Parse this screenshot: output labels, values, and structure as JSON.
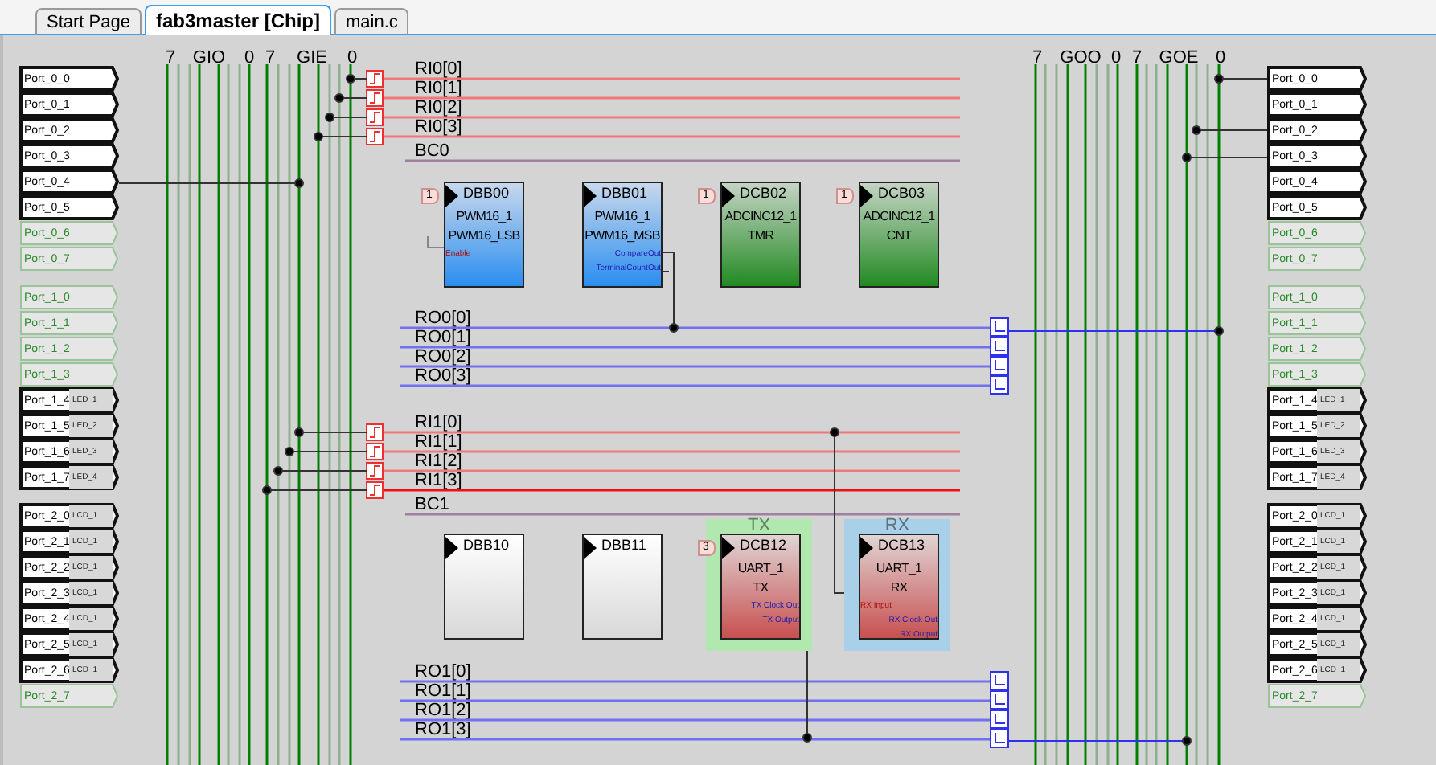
{
  "tabs": [
    {
      "label": "Start Page",
      "selected": false
    },
    {
      "label": "fab3master [Chip]",
      "selected": true
    },
    {
      "label": "main.c",
      "selected": false
    }
  ],
  "left_bus_header": [
    "7",
    "GIO",
    "0",
    "7",
    "GIE",
    "0"
  ],
  "right_bus_header": [
    "7",
    "GOO",
    "0",
    "7",
    "GOE",
    "0"
  ],
  "left_ports": [
    [
      {
        "label": "Port_0_0",
        "enabled": true
      },
      {
        "label": "Port_0_1",
        "enabled": true
      },
      {
        "label": "Port_0_2",
        "enabled": true
      },
      {
        "label": "Port_0_3",
        "enabled": true
      },
      {
        "label": "Port_0_4",
        "enabled": true
      },
      {
        "label": "Port_0_5",
        "enabled": true
      },
      {
        "label": "Port_0_6",
        "enabled": false
      },
      {
        "label": "Port_0_7",
        "enabled": false
      }
    ],
    [
      {
        "label": "Port_1_0",
        "enabled": false
      },
      {
        "label": "Port_1_1",
        "enabled": false
      },
      {
        "label": "Port_1_2",
        "enabled": false
      },
      {
        "label": "Port_1_3",
        "enabled": false
      },
      {
        "label": "Port_1_4",
        "enabled": true,
        "alias": "LED_1"
      },
      {
        "label": "Port_1_5",
        "enabled": true,
        "alias": "LED_2"
      },
      {
        "label": "Port_1_6",
        "enabled": true,
        "alias": "LED_3"
      },
      {
        "label": "Port_1_7",
        "enabled": true,
        "alias": "LED_4"
      }
    ],
    [
      {
        "label": "Port_2_0",
        "enabled": true,
        "alias": "LCD_1"
      },
      {
        "label": "Port_2_1",
        "enabled": true,
        "alias": "LCD_1"
      },
      {
        "label": "Port_2_2",
        "enabled": true,
        "alias": "LCD_1"
      },
      {
        "label": "Port_2_3",
        "enabled": true,
        "alias": "LCD_1"
      },
      {
        "label": "Port_2_4",
        "enabled": true,
        "alias": "LCD_1"
      },
      {
        "label": "Port_2_5",
        "enabled": true,
        "alias": "LCD_1"
      },
      {
        "label": "Port_2_6",
        "enabled": true,
        "alias": "LCD_1"
      },
      {
        "label": "Port_2_7",
        "enabled": false
      }
    ]
  ],
  "right_ports": [
    [
      {
        "label": "Port_0_0",
        "enabled": true
      },
      {
        "label": "Port_0_1",
        "enabled": true
      },
      {
        "label": "Port_0_2",
        "enabled": true
      },
      {
        "label": "Port_0_3",
        "enabled": true
      },
      {
        "label": "Port_0_4",
        "enabled": true
      },
      {
        "label": "Port_0_5",
        "enabled": true
      },
      {
        "label": "Port_0_6",
        "enabled": false
      },
      {
        "label": "Port_0_7",
        "enabled": false
      }
    ],
    [
      {
        "label": "Port_1_0",
        "enabled": false
      },
      {
        "label": "Port_1_1",
        "enabled": false
      },
      {
        "label": "Port_1_2",
        "enabled": false
      },
      {
        "label": "Port_1_3",
        "enabled": false
      },
      {
        "label": "Port_1_4",
        "enabled": true,
        "alias": "LED_1"
      },
      {
        "label": "Port_1_5",
        "enabled": true,
        "alias": "LED_2"
      },
      {
        "label": "Port_1_6",
        "enabled": true,
        "alias": "LED_3"
      },
      {
        "label": "Port_1_7",
        "enabled": true,
        "alias": "LED_4"
      }
    ],
    [
      {
        "label": "Port_2_0",
        "enabled": true,
        "alias": "LCD_1"
      },
      {
        "label": "Port_2_1",
        "enabled": true,
        "alias": "LCD_1"
      },
      {
        "label": "Port_2_2",
        "enabled": true,
        "alias": "LCD_1"
      },
      {
        "label": "Port_2_3",
        "enabled": true,
        "alias": "LCD_1"
      },
      {
        "label": "Port_2_4",
        "enabled": true,
        "alias": "LCD_1"
      },
      {
        "label": "Port_2_5",
        "enabled": true,
        "alias": "LCD_1"
      },
      {
        "label": "Port_2_6",
        "enabled": true,
        "alias": "LCD_1"
      },
      {
        "label": "Port_2_7",
        "enabled": false
      }
    ]
  ],
  "block_rows": [
    {
      "inputs": [
        "RI0[0]",
        "RI0[1]",
        "RI0[2]",
        "RI0[3]"
      ],
      "clock": "BC0",
      "blocks": [
        {
          "id": "DBB00",
          "kind": "pwm",
          "badge": "1",
          "name": [
            "PWM16_1",
            "PWM16_LSB"
          ],
          "pins": [
            {
              "label": "Enable",
              "kind": "input"
            }
          ]
        },
        {
          "id": "DBB01",
          "kind": "pwm",
          "name": [
            "PWM16_1",
            "PWM16_MSB"
          ],
          "pins": [
            {
              "label": "CompareOut",
              "kind": "output"
            },
            {
              "label": "TerminalCountOut",
              "kind": "output"
            }
          ]
        },
        {
          "id": "DCB02",
          "kind": "adc",
          "badge": "1",
          "name": [
            "ADCINC12_1",
            "TMR"
          ]
        },
        {
          "id": "DCB03",
          "kind": "adc",
          "badge": "1",
          "name": [
            "ADCINC12_1",
            "CNT"
          ]
        }
      ],
      "outputs": [
        "RO0[0]",
        "RO0[1]",
        "RO0[2]",
        "RO0[3]"
      ]
    },
    {
      "inputs": [
        "RI1[0]",
        "RI1[1]",
        "RI1[2]",
        "RI1[3]"
      ],
      "clock": "BC1",
      "blocks": [
        {
          "id": "DBB10",
          "kind": "empty"
        },
        {
          "id": "DBB11",
          "kind": "empty"
        },
        {
          "id": "DCB12",
          "kind": "uart",
          "badge": "3",
          "group": {
            "label": "TX",
            "color": "#b0e8b0"
          },
          "name": [
            "UART_1",
            "TX"
          ],
          "pins": [
            {
              "label": "TX Clock Out",
              "kind": "output"
            },
            {
              "label": "TX Output",
              "kind": "output"
            }
          ]
        },
        {
          "id": "DCB13",
          "kind": "uart",
          "group": {
            "label": "RX",
            "color": "#a8d0e8"
          },
          "name": [
            "UART_1",
            "RX"
          ],
          "pins": [
            {
              "label": "RX Input",
              "kind": "input"
            },
            {
              "label": "RX Clock Out",
              "kind": "output"
            },
            {
              "label": "RX Output",
              "kind": "output"
            }
          ]
        }
      ],
      "outputs": [
        "RO1[0]",
        "RO1[1]",
        "RO1[2]",
        "RO1[3]"
      ]
    }
  ]
}
